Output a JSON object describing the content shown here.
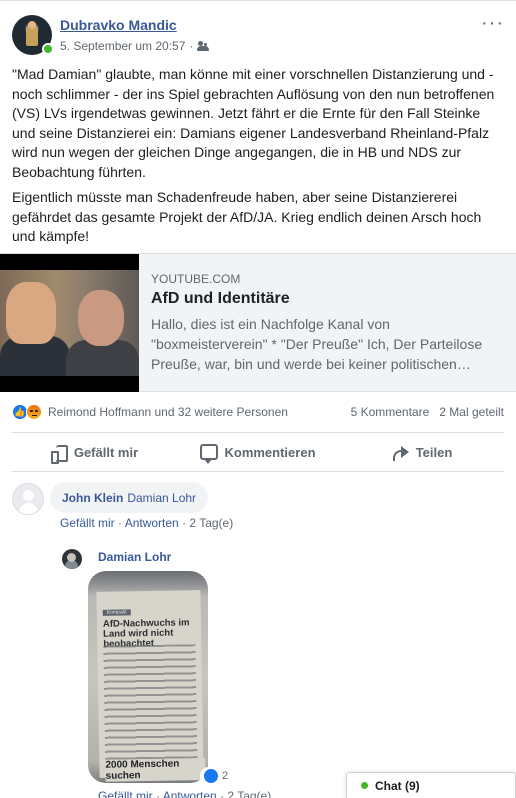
{
  "post": {
    "author": "Dubravko Mandic",
    "timestamp": "5. September um 20:57",
    "separator": "·",
    "audience_icon": "friends-icon",
    "more_label": "···",
    "paragraph1": "\"Mad Damian\" glaubte, man könne mit einer vorschnellen Distanzierung und - noch schlimmer - der ins Spiel gebrachten Auflösung von den nun betroffenen (VS) LVs irgendetwas gewinnen. Jetzt fährt er die Ernte für den Fall Steinke und seine Distanzierei ein: Damians eigener Landesverband Rheinland-Pfalz wird nun wegen der gleichen Dinge angegangen, die in HB und NDS zur Beobachtung führten.",
    "paragraph2": "Eigentlich müsste man Schadenfreude haben, aber seine Distanziererei gefährdet das gesamte Projekt der AfD/JA. Krieg endlich deinen Arsch hoch und kämpfe!"
  },
  "link_card": {
    "domain": "YOUTUBE.COM",
    "title": "AfD und Identitäre",
    "description": "Hallo, dies ist ein Nachfolge Kanal von \"boxmeisterverein\" * \"Der Preuße\" Ich, Der Parteilose Preuße, war, bin und werde bei keiner politischen…"
  },
  "reactions": {
    "icons": [
      "like-icon",
      "angry-icon"
    ],
    "names": "Reimond Hoffmann und 32 weitere Personen",
    "comments": "5 Kommentare",
    "shares": "2 Mal geteilt"
  },
  "actions": {
    "like": "Gefällt mir",
    "comment": "Kommentieren",
    "share": "Teilen"
  },
  "comments": [
    {
      "author": "John Klein",
      "text": "Damian Lohr",
      "like_label": "Gefällt mir",
      "reply_label": "Antworten",
      "age": "2 Tag(e)",
      "dot": "·"
    }
  ],
  "reply": {
    "author": "Damian Lohr",
    "photo_headline": "AfD-Nachwuchs im Land wird nicht beobachtet",
    "photo_kicker": "Kompakt",
    "photo_bottom": "2000 Menschen suchen",
    "like_count": "2",
    "like_label": "Gefällt mir",
    "reply_label": "Antworten",
    "age": "2 Tag(e)"
  },
  "chat": {
    "label": "Chat (9)"
  },
  "colors": {
    "link_blue": "#385898",
    "online_green": "#42b72a",
    "like_blue": "#1877f2",
    "muted": "#606770"
  }
}
